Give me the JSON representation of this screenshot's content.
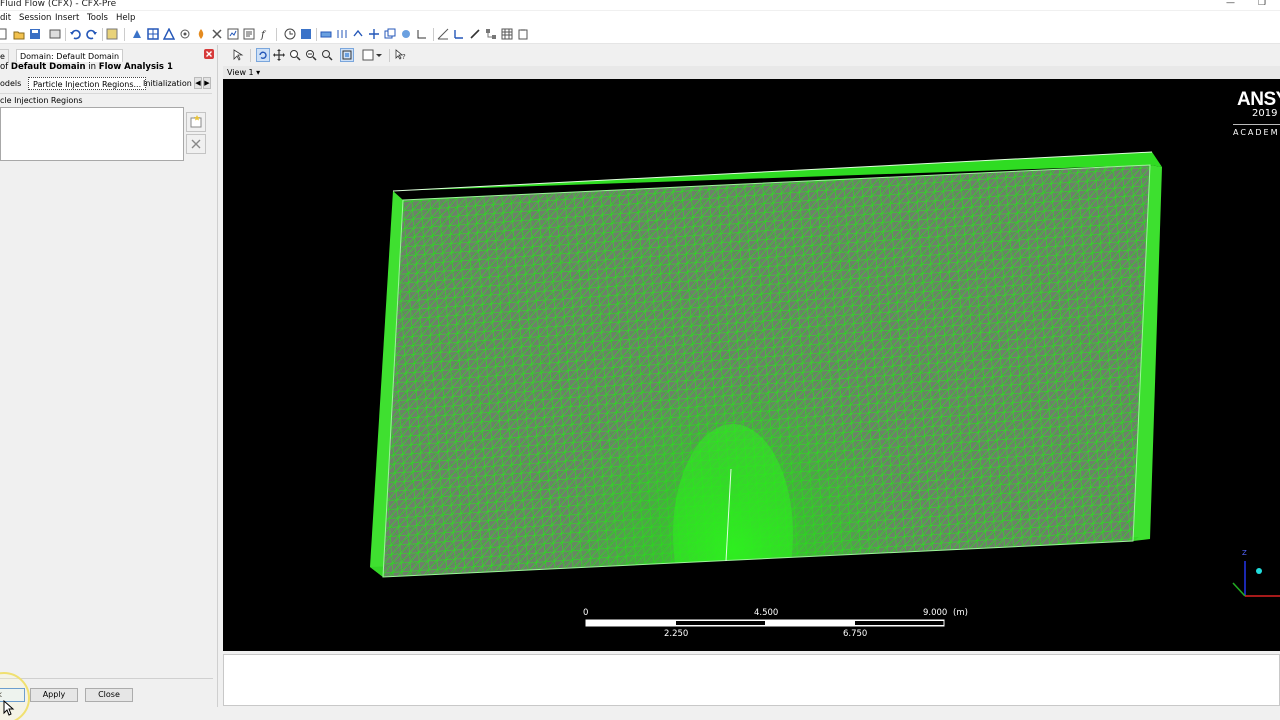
{
  "window": {
    "title": "Fluid Flow (CFX) - CFX-Pre",
    "minimize_glyph": "—",
    "restore_glyph": "❐"
  },
  "menu": [
    "dit",
    "Session",
    "Insert",
    "Tools",
    "Help"
  ],
  "left_panel": {
    "tabs": [
      "e",
      "Domain: Default Domain"
    ],
    "heading_prefix": "of",
    "heading_domain": "Default Domain",
    "heading_mid": "in",
    "heading_analysis": "Flow Analysis 1",
    "subtabs": [
      "odels",
      "Particle Injection Regions...",
      "Initialization"
    ],
    "active_subtab": "Particle Injection Regions...",
    "list_label": "cle Injection Regions",
    "buttons": {
      "ok": "k",
      "apply": "Apply",
      "close": "Close"
    }
  },
  "view": {
    "label": "View 1",
    "logo": {
      "brand": "ANSY",
      "year": "2019",
      "edition": "ACADEM"
    },
    "scale": {
      "unit": "(m)",
      "top_ticks": [
        "0",
        "4.500",
        "9.000"
      ],
      "bottom_ticks": [
        "2.250",
        "6.750"
      ]
    },
    "axis_label": "Z",
    "mesh_color": "#27e11e",
    "background": "#000000"
  },
  "icons": [
    "new-icon",
    "open-icon",
    "save-icon",
    "undo-icon",
    "redo-icon",
    "select-icon",
    "rotate-icon",
    "pan-icon",
    "zoom-icon",
    "zoom-box-icon",
    "fit-view-icon",
    "view-box-icon",
    "help-pointer-icon",
    "panel-close-icon",
    "add-item-icon",
    "delete-item-icon"
  ]
}
